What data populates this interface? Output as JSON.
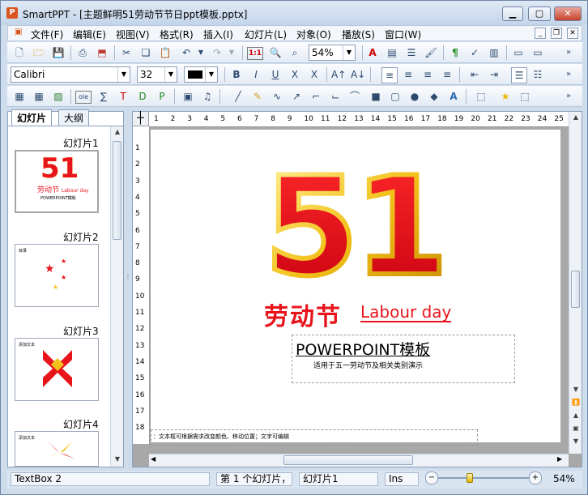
{
  "window": {
    "title": "SmartPPT - [主题鲜明51劳动节节日ppt模板.pptx]",
    "app_icon": "P"
  },
  "menu": [
    "文件(F)",
    "编辑(E)",
    "视图(V)",
    "格式(R)",
    "插入(I)",
    "幻灯片(L)",
    "对象(O)",
    "播放(S)",
    "窗口(W)"
  ],
  "toolbar1": {
    "zoom": "54%",
    "badge_11": "1:1"
  },
  "toolbar2": {
    "font_name": "Calibri",
    "font_size": "32"
  },
  "toolbar3": {
    "ole": "ole"
  },
  "panel": {
    "tabs": [
      "幻灯片",
      "大纲"
    ],
    "thumbs": [
      {
        "label": "幻灯片1",
        "caption": "POWERPOINT模板"
      },
      {
        "label": "幻灯片2",
        "caption": "目录"
      },
      {
        "label": "幻灯片3",
        "caption": "添加文本"
      },
      {
        "label": "幻灯片4",
        "caption": "添加文本"
      }
    ]
  },
  "ruler": {
    "h": [
      "1",
      "2",
      "3",
      "4",
      "5",
      "6",
      "7",
      "8",
      "9",
      "10",
      "11",
      "12",
      "13",
      "14",
      "15",
      "16",
      "17",
      "18",
      "19",
      "20",
      "21",
      "22",
      "23",
      "24",
      "25"
    ],
    "v": [
      "1",
      "2",
      "3",
      "4",
      "5",
      "6",
      "7",
      "8",
      "9",
      "10",
      "11",
      "12",
      "13",
      "14",
      "15",
      "16",
      "17",
      "18"
    ]
  },
  "slide": {
    "big_number": "51",
    "holiday_cn": "劳动节",
    "holiday_en": "Labour day",
    "heading": "POWERPOINT模板",
    "subheading": "适用于五一劳动节及相关类别演示",
    "footer_note": "：文本框可根据需求改变颜色、移动位置；文字可编辑"
  },
  "status": {
    "object": "TextBox 2",
    "slide_index": "第 1 个幻灯片，",
    "slide_name": "幻灯片1",
    "mode": "Ins",
    "zoom": "54%",
    "zoom_level": 0.54
  },
  "colors": {
    "accent_red": "#e8141c",
    "accent_gold": "#f2c21a"
  }
}
